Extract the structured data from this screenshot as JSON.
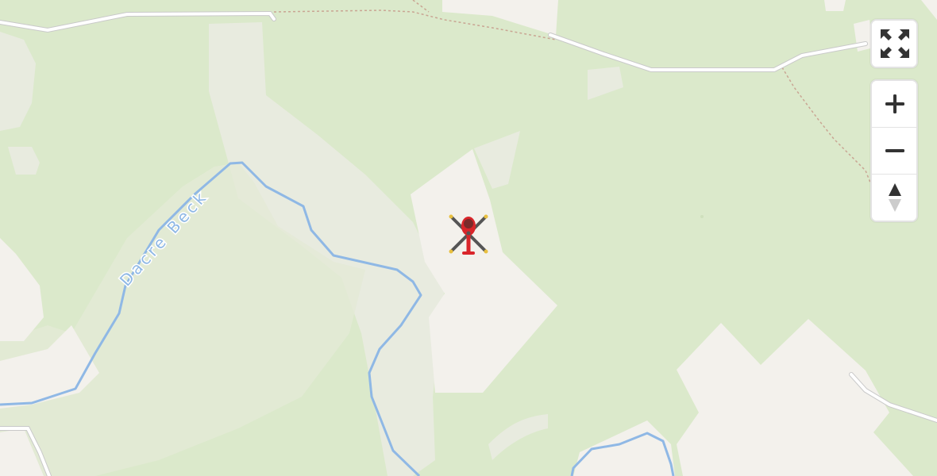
{
  "map": {
    "labels": {
      "river": "Dacre Beck"
    },
    "marker": {
      "icon": "helicopter-icon"
    },
    "colors": {
      "land": "#dbe9cb",
      "clearing": "#f3f1ec",
      "path_area": "#e8ebdf",
      "water": "#8fb8e5",
      "road": "#ffffff",
      "footpath": "#c9a593",
      "marker_red": "#d9252a"
    }
  },
  "controls": {
    "fullscreen_icon": "fullscreen-icon",
    "zoom_in_icon": "plus-icon",
    "zoom_out_icon": "minus-icon",
    "compass_icon": "compass-icon"
  }
}
